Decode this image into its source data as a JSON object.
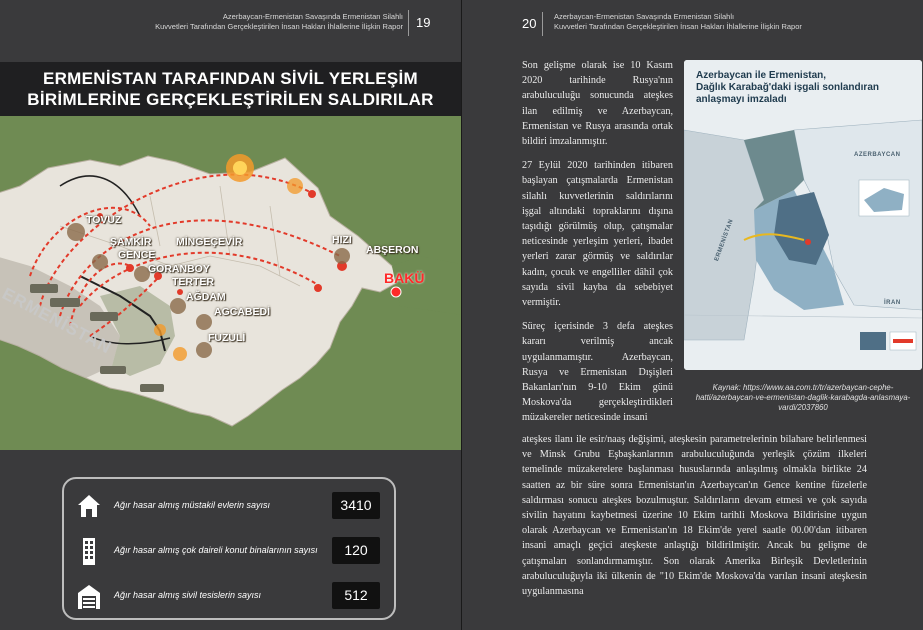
{
  "left_page": {
    "header_line1": "Azerbaycan-Ermenistan Savaşında Ermenistan Silahlı",
    "header_line2": "Kuvvetleri Tarafından Gerçekleştirilen İnsan Hakları İhlallerine İlişkin Rapor",
    "page_number": "19",
    "title_line1": "ERMENİSTAN TARAFINDAN SİVİL YERLEŞİM",
    "title_line2": "BİRİMLERİNE GERÇEKLEŞTİRİLEN SALDIRILAR",
    "map": {
      "country_label": "ERMENİSTAN",
      "places": {
        "tovuz": "TOVUZ",
        "samkir": "ŞAMKİR",
        "gence": "GENCE",
        "mingecevir": "MİNGEÇEVİR",
        "goranboy": "GORANBOY",
        "terter": "TERTER",
        "agdam": "AĞDAM",
        "agcabedi": "AGCABEDİ",
        "fuzuli": "FUZULİ",
        "hizi": "HIZI",
        "abseron": "ABŞERON",
        "baku": "BAKÜ"
      },
      "colors": {
        "land": "#e8e4dc",
        "background": "#6f8b53",
        "missile_path": "#e23a2a",
        "baku": "#ff2a2a"
      }
    },
    "stats": [
      {
        "label": "Ağır hasar almış müstakil evlerin sayısı",
        "value": "3410",
        "icon": "house-icon"
      },
      {
        "label": "Ağır hasar almış çok daireli konut binalarının sayısı",
        "value": "120",
        "icon": "apartment-icon"
      },
      {
        "label": "Ağır hasar almış sivil tesislerin sayısı",
        "value": "512",
        "icon": "facility-icon"
      }
    ]
  },
  "right_page": {
    "page_number": "20",
    "header_line1": "Azerbaycan-Ermenistan Savaşında Ermenistan Silahlı",
    "header_line2": "Kuvvetleri Tarafından Gerçekleştirilen İnsan Hakları İhlallerine İlişkin Rapor",
    "paragraph1": "Son gelişme olarak ise 10 Kasım 2020 tarihinde Rusya'nın arabuluculuğu sonucunda ateşkes ilan edilmiş ve Azerbaycan, Ermenistan ve Rusya arasında ortak bildiri imzalanmıştır.",
    "paragraph2": "27 Eylül 2020 tarihinden itibaren başlayan çatışmalarda Ermenistan silahlı kuvvetlerinin saldırılarını işgal altındaki topraklarını dışına taşıdığı görülmüş olup, çatışmalar neticesinde yerleşim yerleri, ibadet yerleri zarar görmüş ve saldırılar kadın, çocuk ve engelliler dâhil çok sayıda sivil kayba da sebebiyet vermiştir.",
    "paragraph3": "Süreç içerisinde 3 defa ateşkes kararı verilmiş ancak uygulanmamıştır. Azerbaycan, Rusya ve Ermenistan Dışişleri Bakanları'nın 9-10 Ekim günü Moskova'da gerçekleştirdikleri müzakereler neticesinde insani",
    "paragraph_wide": "ateşkes ilanı ile esir/naaş değişimi, ateşkesin parametrelerinin bilahare belirlenmesi ve Minsk Grubu Eşbaşkanlarının arabuluculuğunda yerleşik çözüm ilkeleri temelinde müzakerelere başlanması hususlarında anlaşılmış olmakla birlikte 24 saatten az bir süre sonra Ermenistan'ın Azerbaycan'ın Gence kentine füzelerle saldırması sonucu ateşkes bozulmuştur. Saldırıların devam etmesi ve çok sayıda sivilin hayatını kaybetmesi üzerine 10 Ekim tarihli Moskova Bildirisine uygun olarak Azerbaycan ve Ermenistan'ın 18 Ekim'de yerel saatle 00.00'dan itibaren insani amaçlı geçici ateşkeste anlaştığı bildirilmiştir. Ancak bu gelişme de çatışmaları sonlandırmamıştır. Son olarak Amerika Birleşik Devletlerinin arabuluculuğuyla iki ülkenin de \"10 Ekim'de Moskova'da varılan insani ateşkesin uygulanmasına",
    "inset": {
      "title_line1": "Azerbaycan ile Ermenistan,",
      "title_line2": "Dağlık Karabağ'daki işgali sonlandıran",
      "title_line3": "anlaşmayı imzaladı",
      "label_azerbaycan": "AZERBAYCAN",
      "label_ermenistan": "ERMENİSTAN",
      "label_iran": "İRAN",
      "colors": {
        "occupied": "#4f6f86",
        "liberated": "#8fb0c4",
        "returned": "#6d8a8e",
        "road": "#e8b820"
      }
    },
    "caption": "Kaynak: https://www.aa.com.tr/tr/azerbaycan-cephe-hatti/azerbaycan-ve-ermenistan-daglik-karabagda-anlasmaya-vardi/2037860"
  }
}
